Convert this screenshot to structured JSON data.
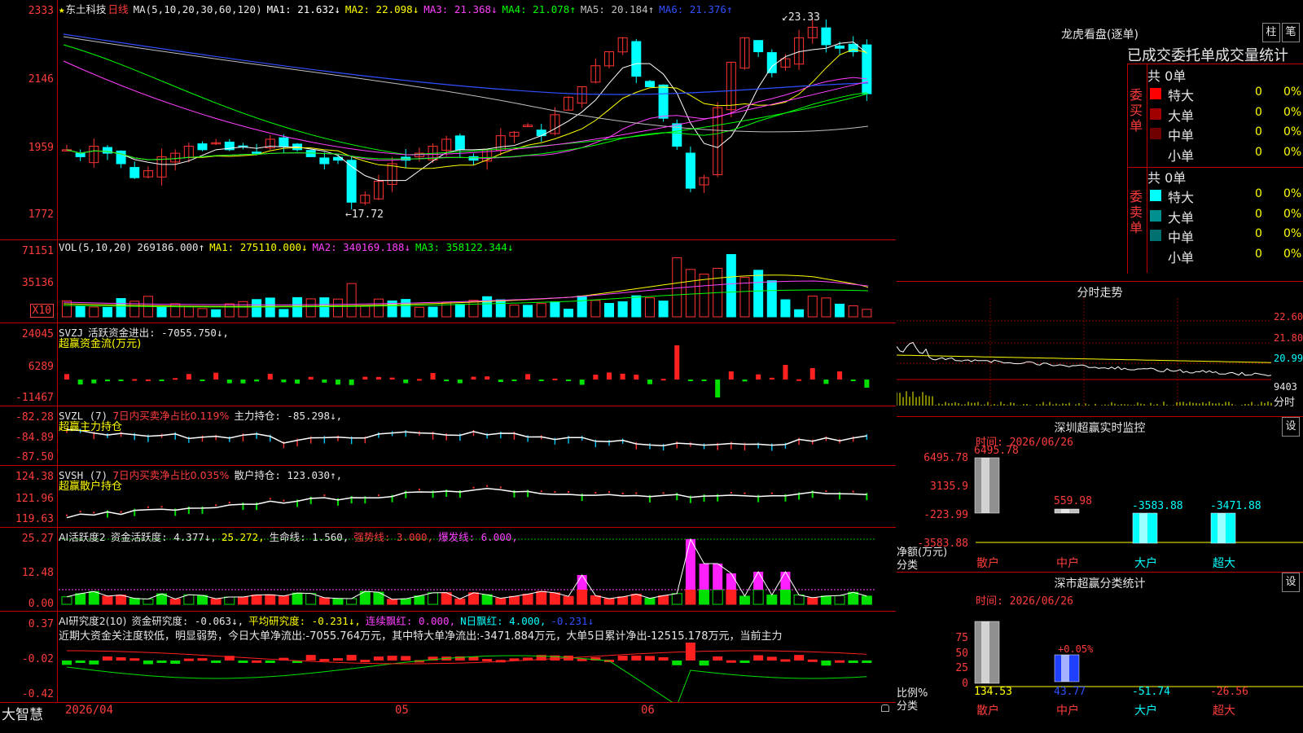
{
  "main": {
    "star": "★",
    "stock": "东土科技",
    "period": "日线",
    "ma_hdr": "MA(5,10,20,30,60,120)",
    "ma": [
      {
        "label": "MA1: 21.632↓",
        "color": "#ffffff"
      },
      {
        "label": "MA2: 22.098↓",
        "color": "#ffff00"
      },
      {
        "label": "MA3: 21.368↓",
        "color": "#ff40ff"
      },
      {
        "label": "MA4: 21.078↑",
        "color": "#00ff00"
      },
      {
        "label": "MA5: 20.184↑",
        "color": "#c0c0c0"
      },
      {
        "label": "MA6: 21.376↑",
        "color": "#3050ff"
      }
    ],
    "y_ticks": [
      "2333",
      "2146",
      "1959",
      "1772"
    ],
    "hi": "23.33",
    "lo": "17.72"
  },
  "vol": {
    "hdr": "VOL(5,10,20)",
    "val": "269186.000↑",
    "ma": [
      {
        "label": "MA1: 275110.000↓",
        "color": "#ffff00"
      },
      {
        "label": "MA2: 340169.188↓",
        "color": "#ff40ff"
      },
      {
        "label": "MA3: 358122.344↓",
        "color": "#00ff00"
      }
    ],
    "y_ticks": [
      "71151",
      "35136"
    ],
    "unit": "X10"
  },
  "svzj": {
    "name": "SVZJ",
    "l1": "活跃资金进出: -7055.750↓,",
    "l2": "超赢资金流(万元)",
    "y_ticks": [
      "24045",
      "6289",
      "-11467"
    ]
  },
  "svzl": {
    "name": "SVZL (7)",
    "pct": "7日内买卖净占比0.119%",
    "pos": "主力持仓: -85.298↓,",
    "l2": "超赢主力持仓",
    "y_ticks": [
      "-82.28",
      "-84.89",
      "-87.50"
    ]
  },
  "svsh": {
    "name": "SVSH (7)",
    "pct": "7日内买卖净占比0.035%",
    "pos": "散户持仓: 123.030↑,",
    "l2": "超赢散户持仓",
    "y_ticks": [
      "124.38",
      "121.96",
      "119.63"
    ]
  },
  "ai2": {
    "name": "AI活跃度2",
    "a": "资金活跃度: 4.377↓,",
    "b": "25.272,",
    "c": "生命线: 1.560,",
    "d": "强势线: 3.000,",
    "e": "爆发线: 6.000,",
    "y_ticks": [
      "25.27",
      "12.48",
      "0.00"
    ]
  },
  "ai3": {
    "name": "AI研究度2(10)",
    "a": "资金研究度: -0.063↓,",
    "b": "平均研究度: -0.231↓,",
    "c": "连续飘红: 0.000,",
    "d": "N日飘红: 4.000,",
    "e": "-0.231↓",
    "note": "近期大资金关注度较低，明显弱势，今日大单净流出:-7055.764万元，其中特大单净流出:-3471.884万元，大单5日累计净出-12515.178万元，当前主力",
    "y_ticks": [
      "0.37",
      "-0.02",
      "-0.42"
    ]
  },
  "xaxis": {
    "brand": "大智慧",
    "labels": [
      "2026/04",
      "05",
      "06"
    ]
  },
  "lhb": {
    "title": "龙虎看盘(逐单)",
    "btn1": "柱",
    "btn2": "笔",
    "sub": "已成交委托单成交量统计",
    "buy": {
      "side": "委买单",
      "total": "共 0单",
      "rows": [
        {
          "name": "特大",
          "v": "0",
          "p": "0%",
          "c": "#ff0000"
        },
        {
          "name": "大单",
          "v": "0",
          "p": "0%",
          "c": "#a00000"
        },
        {
          "name": "中单",
          "v": "0",
          "p": "0%",
          "c": "#700000"
        },
        {
          "name": "小单",
          "v": "0",
          "p": "0%",
          "c": "#000000"
        }
      ]
    },
    "sell": {
      "side": "委卖单",
      "total": "共 0单",
      "rows": [
        {
          "name": "特大",
          "v": "0",
          "p": "0%",
          "c": "#00ffff"
        },
        {
          "name": "大单",
          "v": "0",
          "p": "0%",
          "c": "#009090"
        },
        {
          "name": "中单",
          "v": "0",
          "p": "0%",
          "c": "#007070"
        },
        {
          "name": "小单",
          "v": "0",
          "p": "0%",
          "c": "#000000"
        }
      ]
    }
  },
  "fs": {
    "title": "分时走势",
    "y_ticks": [
      "22.60",
      "21.80",
      "20.99",
      "9403"
    ],
    "unit": "分时"
  },
  "szmon": {
    "title": "深圳超赢实时监控",
    "btn": "设",
    "time": "时间: 2026/06/26",
    "y_ticks": [
      "6495.78",
      "3135.9",
      "-223.99",
      "-3583.88"
    ],
    "ylabel": "净额(万元)",
    "xlabel": "分类",
    "bars": [
      {
        "cat": "散户",
        "v": "6495.78"
      },
      {
        "cat": "中户",
        "v": "559.98"
      },
      {
        "cat": "大户",
        "v": "-3583.88"
      },
      {
        "cat": "超大",
        "v": "-3471.88"
      }
    ]
  },
  "szcls": {
    "title": "深市超赢分类统计",
    "btn": "设",
    "time": "时间: 2026/06/26",
    "y_ticks": [
      "75",
      "50",
      "25",
      "0"
    ],
    "ylabel": "比例%",
    "xlabel": "分类",
    "annot": "+0.05%",
    "bars": [
      {
        "cat": "散户",
        "v": "134.53"
      },
      {
        "cat": "中户",
        "v": "43.77"
      },
      {
        "cat": "大户",
        "v": "-51.74"
      },
      {
        "cat": "超大",
        "v": "-26.56"
      }
    ]
  }
}
